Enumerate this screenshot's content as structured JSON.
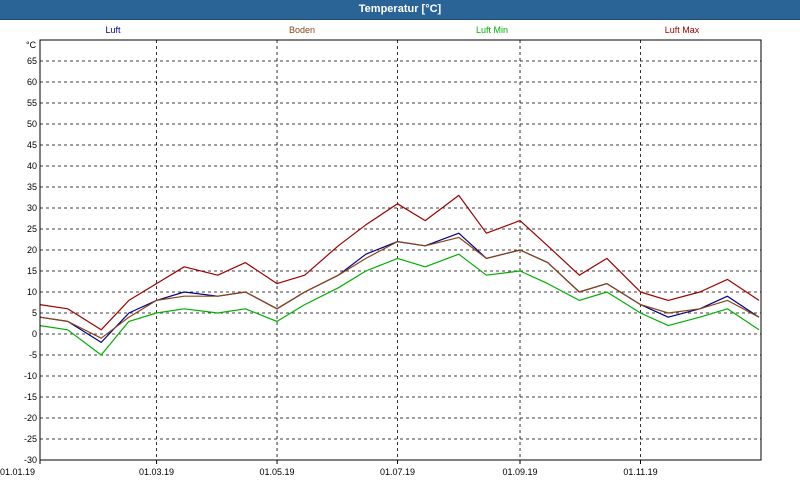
{
  "window": {
    "title": "Temperatur [°C]"
  },
  "chart_data": {
    "type": "line",
    "title": "Temperatur [°C]",
    "ylabel": "°C",
    "ylim": [
      -30,
      70
    ],
    "yticks": [
      -30,
      -25,
      -20,
      -15,
      -10,
      -5,
      0,
      5,
      10,
      15,
      20,
      25,
      30,
      35,
      40,
      45,
      50,
      55,
      60,
      65
    ],
    "xlim": [
      "01.01.19",
      "31.12.19"
    ],
    "xticks": [
      "01.01.19",
      "01.03.19",
      "01.05.19",
      "01.07.19",
      "01.09.19",
      "01.11.19"
    ],
    "grid": true,
    "legend_position": "top",
    "x": [
      "01.01.19",
      "15.01.19",
      "01.02.19",
      "15.02.19",
      "01.03.19",
      "15.03.19",
      "01.04.19",
      "15.04.19",
      "01.05.19",
      "15.05.19",
      "01.06.19",
      "15.06.19",
      "01.07.19",
      "15.07.19",
      "01.08.19",
      "15.08.19",
      "01.09.19",
      "15.09.19",
      "01.10.19",
      "15.10.19",
      "01.11.19",
      "15.11.19",
      "01.12.19",
      "15.12.19",
      "31.12.19"
    ],
    "series": [
      {
        "name": "Luft",
        "color": "#00008b",
        "values": [
          4,
          3,
          -2,
          5,
          8,
          10,
          9,
          10,
          6,
          10,
          14,
          19,
          22,
          21,
          24,
          18,
          20,
          17,
          10,
          12,
          7,
          4,
          6,
          9,
          4
        ]
      },
      {
        "name": "Boden",
        "color": "#8b4513",
        "values": [
          4,
          3,
          -1,
          4,
          8,
          9,
          9,
          10,
          6,
          10,
          14,
          18,
          22,
          21,
          23,
          18,
          20,
          17,
          10,
          12,
          7,
          5,
          6,
          8,
          4
        ]
      },
      {
        "name": "Luft Min",
        "color": "#00b000",
        "values": [
          2,
          1,
          -5,
          3,
          5,
          6,
          5,
          6,
          3,
          7,
          11,
          15,
          18,
          16,
          19,
          14,
          15,
          12,
          8,
          10,
          5,
          2,
          4,
          6,
          1
        ]
      },
      {
        "name": "Luft Max",
        "color": "#a00000",
        "values": [
          7,
          6,
          1,
          8,
          12,
          16,
          14,
          17,
          12,
          14,
          21,
          26,
          31,
          27,
          33,
          24,
          27,
          21,
          14,
          18,
          10,
          8,
          10,
          13,
          8
        ]
      }
    ]
  }
}
